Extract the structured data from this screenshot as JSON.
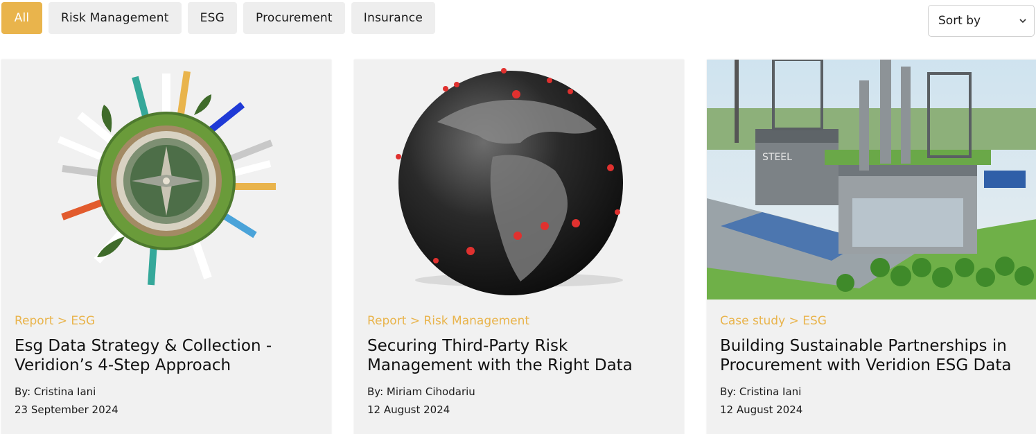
{
  "filters": {
    "items": [
      {
        "label": "All",
        "active": true
      },
      {
        "label": "Risk Management",
        "active": false
      },
      {
        "label": "ESG",
        "active": false
      },
      {
        "label": "Procurement",
        "active": false
      },
      {
        "label": "Insurance",
        "active": false
      }
    ],
    "accent_color": "#e9b44c"
  },
  "sort": {
    "label": "Sort by",
    "icon": "chevron-down-icon"
  },
  "cards": [
    {
      "image": "esg-compass-illustration",
      "breadcrumb": "Report > ESG",
      "title": "Esg Data Strategy & Collection - Veridion’s 4-Step Approach",
      "author": "By: Cristina Iani",
      "date": "23 September 2024"
    },
    {
      "image": "globe-risk-map-illustration",
      "breadcrumb": "Report > Risk Management",
      "title": "Securing Third-Party Risk Management with the Right Data",
      "author": "By: Miriam Cihodariu",
      "date": "12 August 2024"
    },
    {
      "image": "green-steel-factory-illustration",
      "breadcrumb": "Case study > ESG",
      "title": "Building Sustainable Partnerships in Procurement with Veridion ESG Data",
      "author": "By: Cristina Iani",
      "date": "12 August 2024"
    }
  ]
}
